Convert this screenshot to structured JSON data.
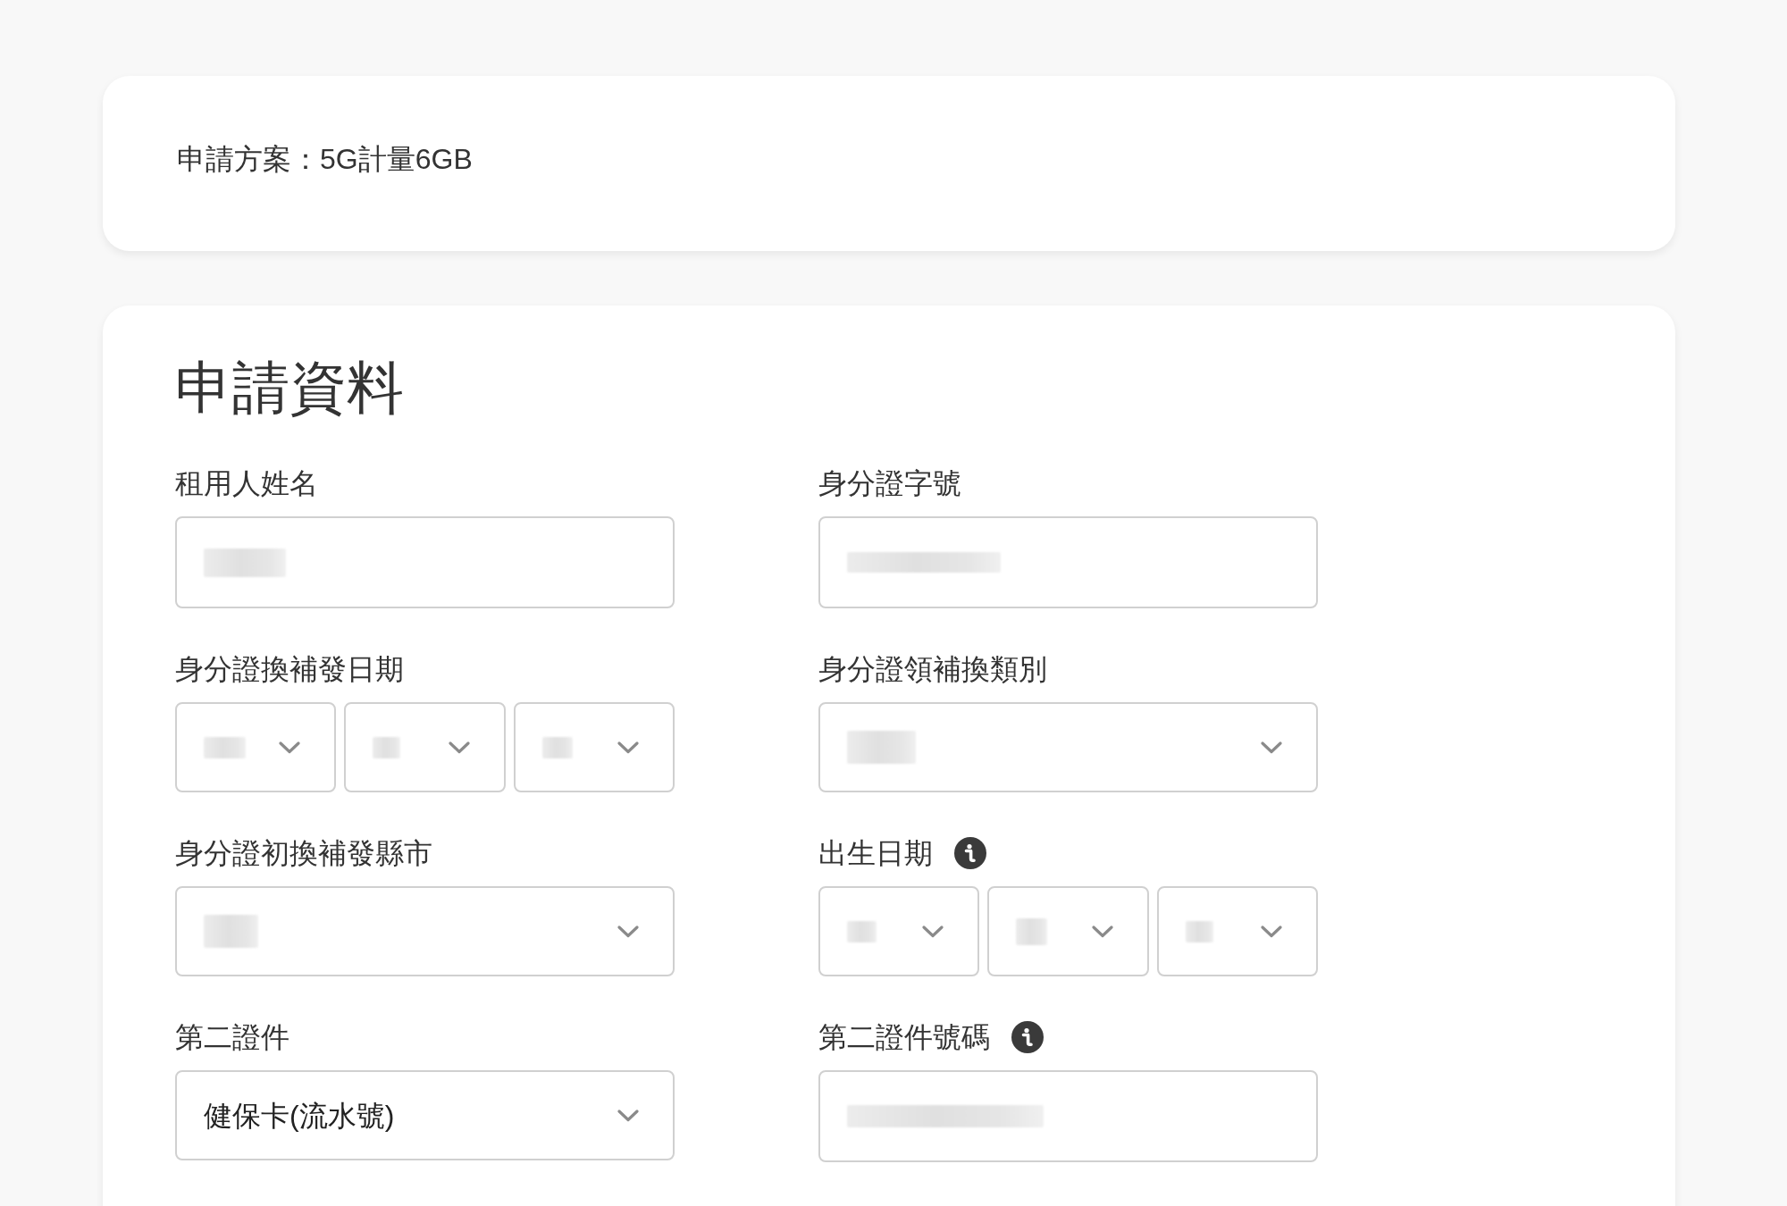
{
  "plan_card": {
    "text": "申請方案：5G計量6GB"
  },
  "form": {
    "title": "申請資料",
    "fields": [
      {
        "label": "租用人姓名",
        "kind": "text",
        "info": false,
        "redacted": true
      },
      {
        "label": "身分證字號",
        "kind": "text",
        "info": false,
        "redacted": true
      },
      {
        "label": "身分證換補發日期",
        "kind": "date",
        "info": false,
        "parts": [
          {
            "redacted": true
          },
          {
            "redacted": true
          },
          {
            "redacted": true
          }
        ]
      },
      {
        "label": "身分證領補換類別",
        "kind": "select",
        "info": false,
        "redacted": true
      },
      {
        "label": "身分證初換補發縣市",
        "kind": "select",
        "info": false,
        "redacted": true
      },
      {
        "label": "出生日期",
        "kind": "date",
        "info": true,
        "parts": [
          {
            "redacted": true
          },
          {
            "redacted": true
          },
          {
            "redacted": true
          }
        ]
      },
      {
        "label": "第二證件",
        "kind": "select",
        "info": false,
        "redacted": false,
        "value": "健保卡(流水號)"
      },
      {
        "label": "第二證件號碼",
        "kind": "text",
        "info": true,
        "redacted": true
      }
    ]
  }
}
